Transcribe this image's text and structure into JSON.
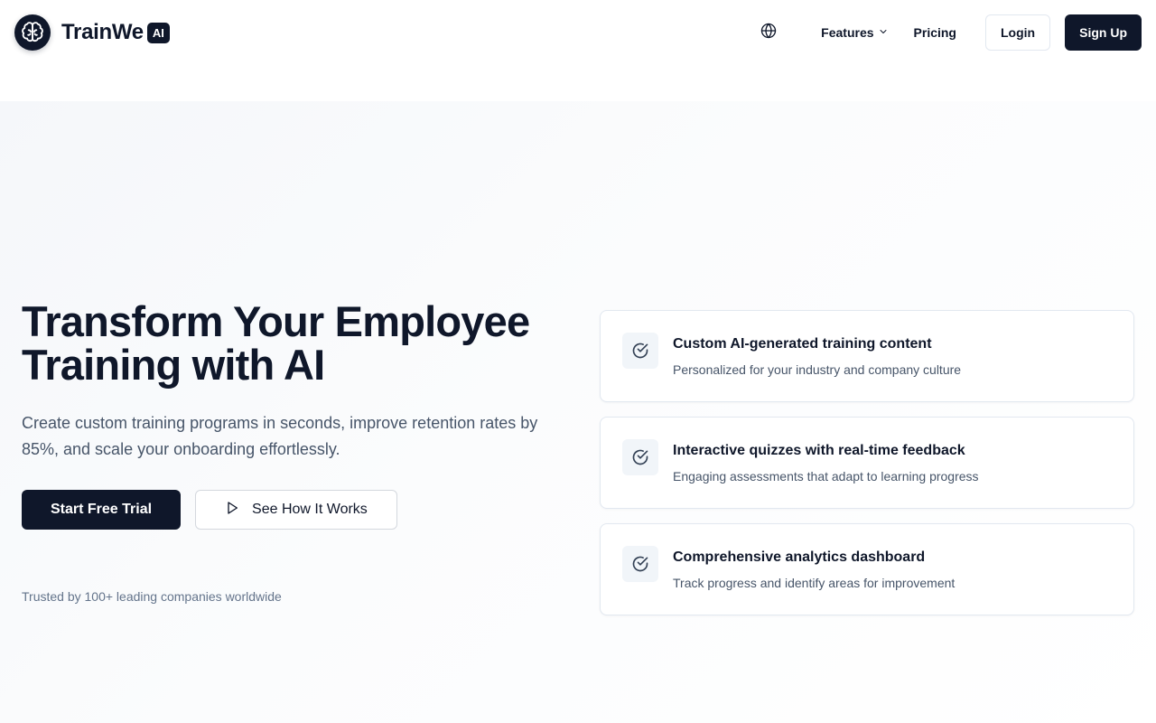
{
  "header": {
    "brand_name": "TrainWe",
    "brand_badge": "AI",
    "logo_icon": "brain-icon",
    "globe_icon": "globe-icon",
    "nav": {
      "features_label": "Features",
      "pricing_label": "Pricing"
    },
    "login_label": "Login",
    "signup_label": "Sign Up"
  },
  "hero": {
    "title_line1": "Transform Your Employee",
    "title_line2": "Training with AI",
    "subtitle": "Create custom training programs in seconds, improve retention rates by 85%, and scale your onboarding effortlessly.",
    "primary_cta": "Start Free Trial",
    "secondary_cta": "See How It Works",
    "trusted_text": "Trusted by 100+ leading companies worldwide"
  },
  "features": [
    {
      "title": "Custom AI-generated training content",
      "description": "Personalized for your industry and company culture",
      "icon": "check-circle-icon"
    },
    {
      "title": "Interactive quizzes with real-time feedback",
      "description": "Engaging assessments that adapt to learning progress",
      "icon": "check-circle-icon"
    },
    {
      "title": "Comprehensive analytics dashboard",
      "description": "Track progress and identify areas for improvement",
      "icon": "check-circle-icon"
    }
  ],
  "colors": {
    "primary": "#0f172a",
    "text_muted": "#475569",
    "border": "#e2e8f0"
  }
}
